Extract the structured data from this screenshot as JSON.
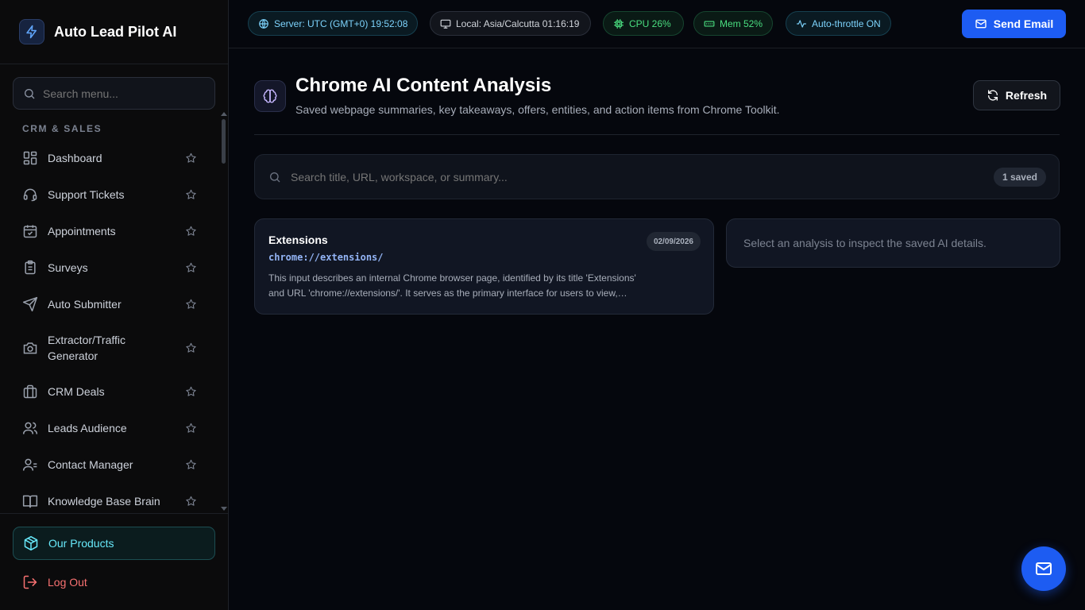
{
  "brand": {
    "title": "Auto Lead Pilot AI",
    "icon": "bolt-icon"
  },
  "sidebar": {
    "search_placeholder": "Search menu...",
    "section_label": "CRM & SALES",
    "items": [
      {
        "label": "Dashboard",
        "icon": "dashboard-icon"
      },
      {
        "label": "Support Tickets",
        "icon": "headset-icon"
      },
      {
        "label": "Appointments",
        "icon": "calendar-check-icon"
      },
      {
        "label": "Surveys",
        "icon": "clipboard-icon"
      },
      {
        "label": "Auto Submitter",
        "icon": "send-icon"
      },
      {
        "label": "Extractor/Traffic Generator",
        "icon": "camera-icon"
      },
      {
        "label": "CRM Deals",
        "icon": "briefcase-icon"
      },
      {
        "label": "Leads Audience",
        "icon": "users-icon"
      },
      {
        "label": "Contact Manager",
        "icon": "contacts-icon"
      },
      {
        "label": "Knowledge Base Brain",
        "icon": "book-open-icon"
      }
    ],
    "footer": {
      "products_label": "Our Products",
      "logout_label": "Log Out"
    }
  },
  "topbar": {
    "server_time": "Server: UTC (GMT+0) 19:52:08",
    "local_time": "Local: Asia/Calcutta 01:16:19",
    "cpu": "CPU 26%",
    "mem": "Mem 52%",
    "throttle": "Auto-throttle ON",
    "send_email_label": "Send Email"
  },
  "main": {
    "title": "Chrome AI Content Analysis",
    "subtitle": "Saved webpage summaries, key takeaways, offers, entities, and action items from Chrome Toolkit.",
    "refresh_label": "Refresh",
    "search_placeholder": "Search title, URL, workspace, or summary...",
    "saved_count": "1 saved",
    "analyses": [
      {
        "title": "Extensions",
        "url": "chrome://extensions/",
        "date": "02/09/2026",
        "summary": "This input describes an internal Chrome browser page, identified by its title 'Extensions' and URL 'chrome://extensions/'. It serves as the primary interface for users to view,…"
      }
    ],
    "detail_placeholder": "Select an analysis to inspect the saved AI details."
  },
  "colors": {
    "accent": "#1d5cf2",
    "background": "#05070d",
    "cyan": "#67e8f9",
    "green": "#4ade80",
    "danger": "#f87171"
  }
}
